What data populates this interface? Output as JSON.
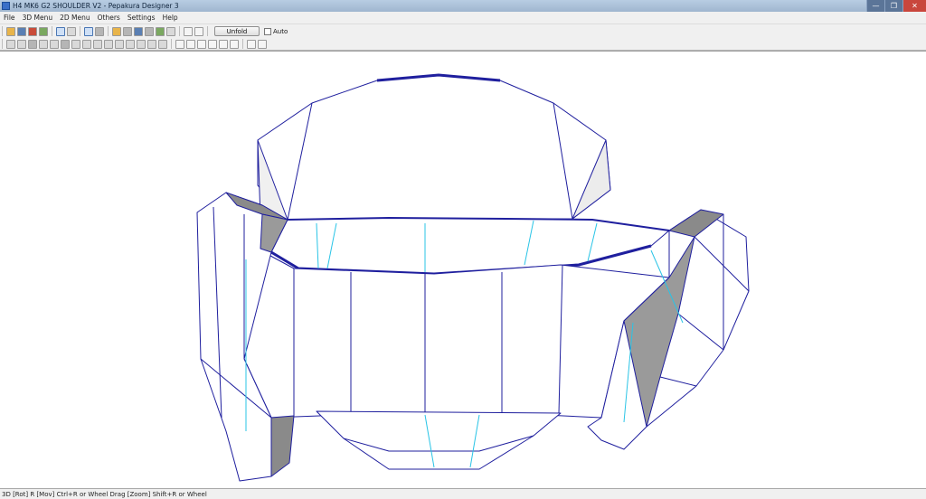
{
  "window": {
    "title": "H4 MK6 G2 SHOULDER V2 - Pepakura Designer 3"
  },
  "menu": [
    "File",
    "3D Menu",
    "2D Menu",
    "Others",
    "Settings",
    "Help"
  ],
  "toolbar": {
    "unfold_label": "Unfold",
    "auto_label": "Auto",
    "auto_checked": false
  },
  "status": {
    "text": "3D [Rot] R [Mov] Ctrl+R or Wheel Drag [Zoom] Shift+R or Wheel"
  },
  "colors": {
    "edge": "#1f1f9e",
    "fold_line": "#29c4e6",
    "shade": "#8a8a8a",
    "background": "#ffffff"
  }
}
